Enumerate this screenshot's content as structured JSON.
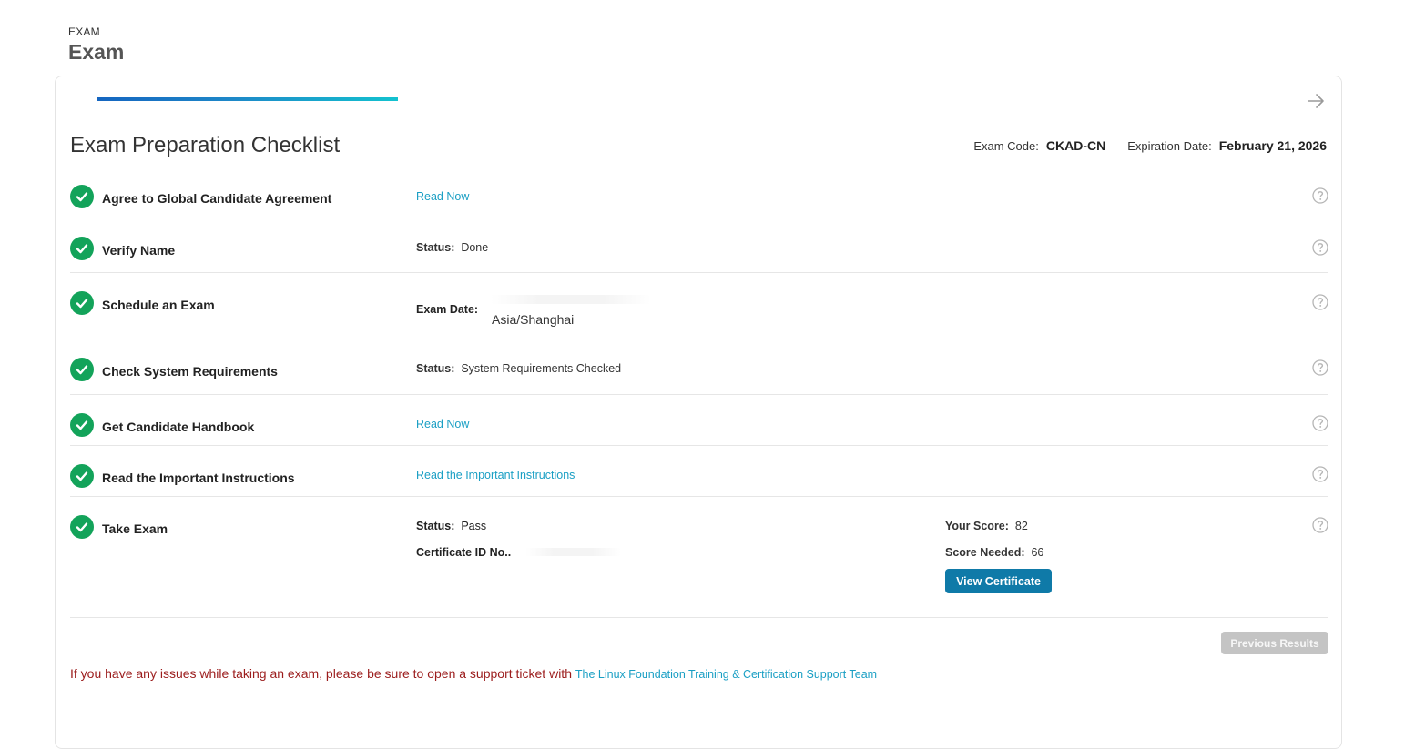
{
  "header": {
    "eyebrow": "EXAM",
    "title": "Exam"
  },
  "progress": {
    "fraction": 0.5
  },
  "checklist": {
    "title": "Exam Preparation Checklist",
    "exam_code_label": "Exam Code:",
    "exam_code": "CKAD-CN",
    "expiration_label": "Expiration Date:",
    "expiration": "February 21, 2026"
  },
  "rows": [
    {
      "label": "Agree to Global Candidate Agreement",
      "link": "Read Now"
    },
    {
      "label": "Verify Name",
      "status_label": "Status:",
      "status": "Done"
    },
    {
      "label": "Schedule an Exam",
      "date_label": "Exam Date:",
      "timezone": "Asia/Shanghai"
    },
    {
      "label": "Check System Requirements",
      "status_label": "Status:",
      "status": "System Requirements Checked"
    },
    {
      "label": "Get Candidate Handbook",
      "link": "Read Now"
    },
    {
      "label": "Read the Important Instructions",
      "link": "Read the Important Instructions"
    },
    {
      "label": "Take Exam",
      "status_label": "Status:",
      "status": "Pass",
      "cert_label": "Certificate ID No..",
      "score_label": "Your Score:",
      "score": "82",
      "needed_label": "Score Needed:",
      "needed": "66",
      "button": "View Certificate"
    }
  ],
  "previous_results": "Previous Results",
  "support": {
    "text": "If you have any issues while taking an exam, please be sure to open a support ticket with",
    "link": "The Linux Foundation Training & Certification Support Team"
  },
  "colors": {
    "check": "#13a35a",
    "link": "#1a9fc4",
    "button": "#0f7aa8",
    "support_text": "#9b1c1c"
  },
  "icons": {
    "check": "check-circle-icon",
    "help": "question-circle-icon",
    "next": "arrow-right-icon"
  }
}
